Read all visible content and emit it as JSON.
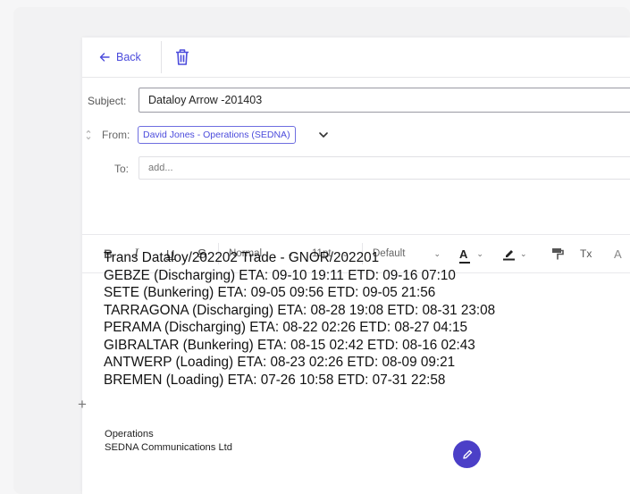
{
  "topbar": {
    "back_label": "Back"
  },
  "header": {
    "subject_label": "Subject:",
    "subject_value": "Dataloy Arrow -201403",
    "from_label": "From:",
    "from_value": "David Jones - Operations (SEDNA)",
    "to_label": "To:",
    "to_placeholder": "add..."
  },
  "toolbar": {
    "bold": "B",
    "italic": "I",
    "underline": "U",
    "strike": "S",
    "paragraph": "Normal",
    "size": "11pt",
    "font": "Default",
    "text_color": "A",
    "clear_format": "Tx",
    "more": "A"
  },
  "body": {
    "lines": [
      "Trans Dataloy/202202 Trade - GNOR/202201",
      "GEBZE (Discharging) ETA: 09-10 19:11 ETD: 09-16 07:10",
      "SETE (Bunkering) ETA: 09-05 09:56 ETD: 09-05 21:56",
      "TARRAGONA (Discharging) ETA: 08-28 19:08 ETD: 08-31 23:08",
      "PERAMA (Discharging) ETA: 08-22 02:26 ETD: 08-27 04:15",
      "GIBRALTAR (Bunkering) ETA: 08-15 02:42 ETD: 08-16 02:43",
      "ANTWERP (Loading) ETA: 08-23 02:26 ETD: 08-09 09:21",
      "BREMEN (Loading) ETA: 07-26 10:58 ETD: 07-31 22:58"
    ],
    "plus": "+"
  },
  "signature": {
    "line1": "Operations",
    "line2": "SEDNA Communications Ltd"
  },
  "colors": {
    "accent": "#4b4bdc",
    "fab": "#4b3fc7"
  },
  "icons": [
    "arrow-left-icon",
    "trash-icon",
    "collapse-icon",
    "chevron-down-icon",
    "highlighter-icon",
    "paint-format-icon",
    "pencil-icon"
  ]
}
